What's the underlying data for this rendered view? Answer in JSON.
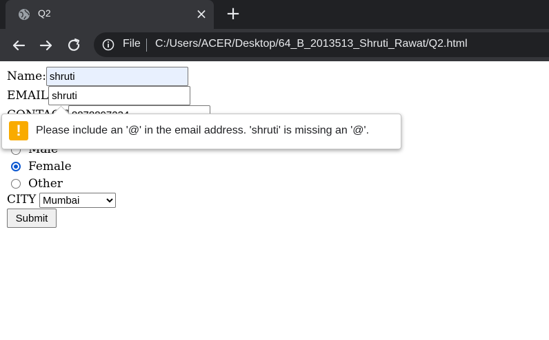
{
  "browser": {
    "tab": {
      "title": "Q2",
      "favicon": "globe-icon"
    },
    "toolbar": {
      "back_icon": "back-arrow-icon",
      "forward_icon": "forward-arrow-icon",
      "reload_icon": "reload-icon"
    },
    "address": {
      "scheme": "File",
      "url": "C:/Users/ACER/Desktop/64_B_2013513_Shruti_Rawat/Q2.html"
    }
  },
  "form": {
    "name_label": "Name:",
    "name_value": "shruti",
    "email_label": "EMAIL",
    "email_value": "shruti",
    "contact_label": "CONTACT",
    "contact_value": "8878897234",
    "gender_options": [
      "Male",
      "Female",
      "Other"
    ],
    "gender_selected": "Female",
    "city_label": "CITY",
    "city_value": "Mumbai",
    "submit_label": "Submit"
  },
  "validation": {
    "message": "Please include an '@' in the email address. 'shruti' is missing an '@'.",
    "icon": "warning-icon"
  },
  "colors": {
    "chrome_dark": "#202124",
    "chrome_tab": "#35363a",
    "autofill": "#e8f0fe",
    "radio_checked": "#0b57d0",
    "warning": "#f9ab00"
  }
}
